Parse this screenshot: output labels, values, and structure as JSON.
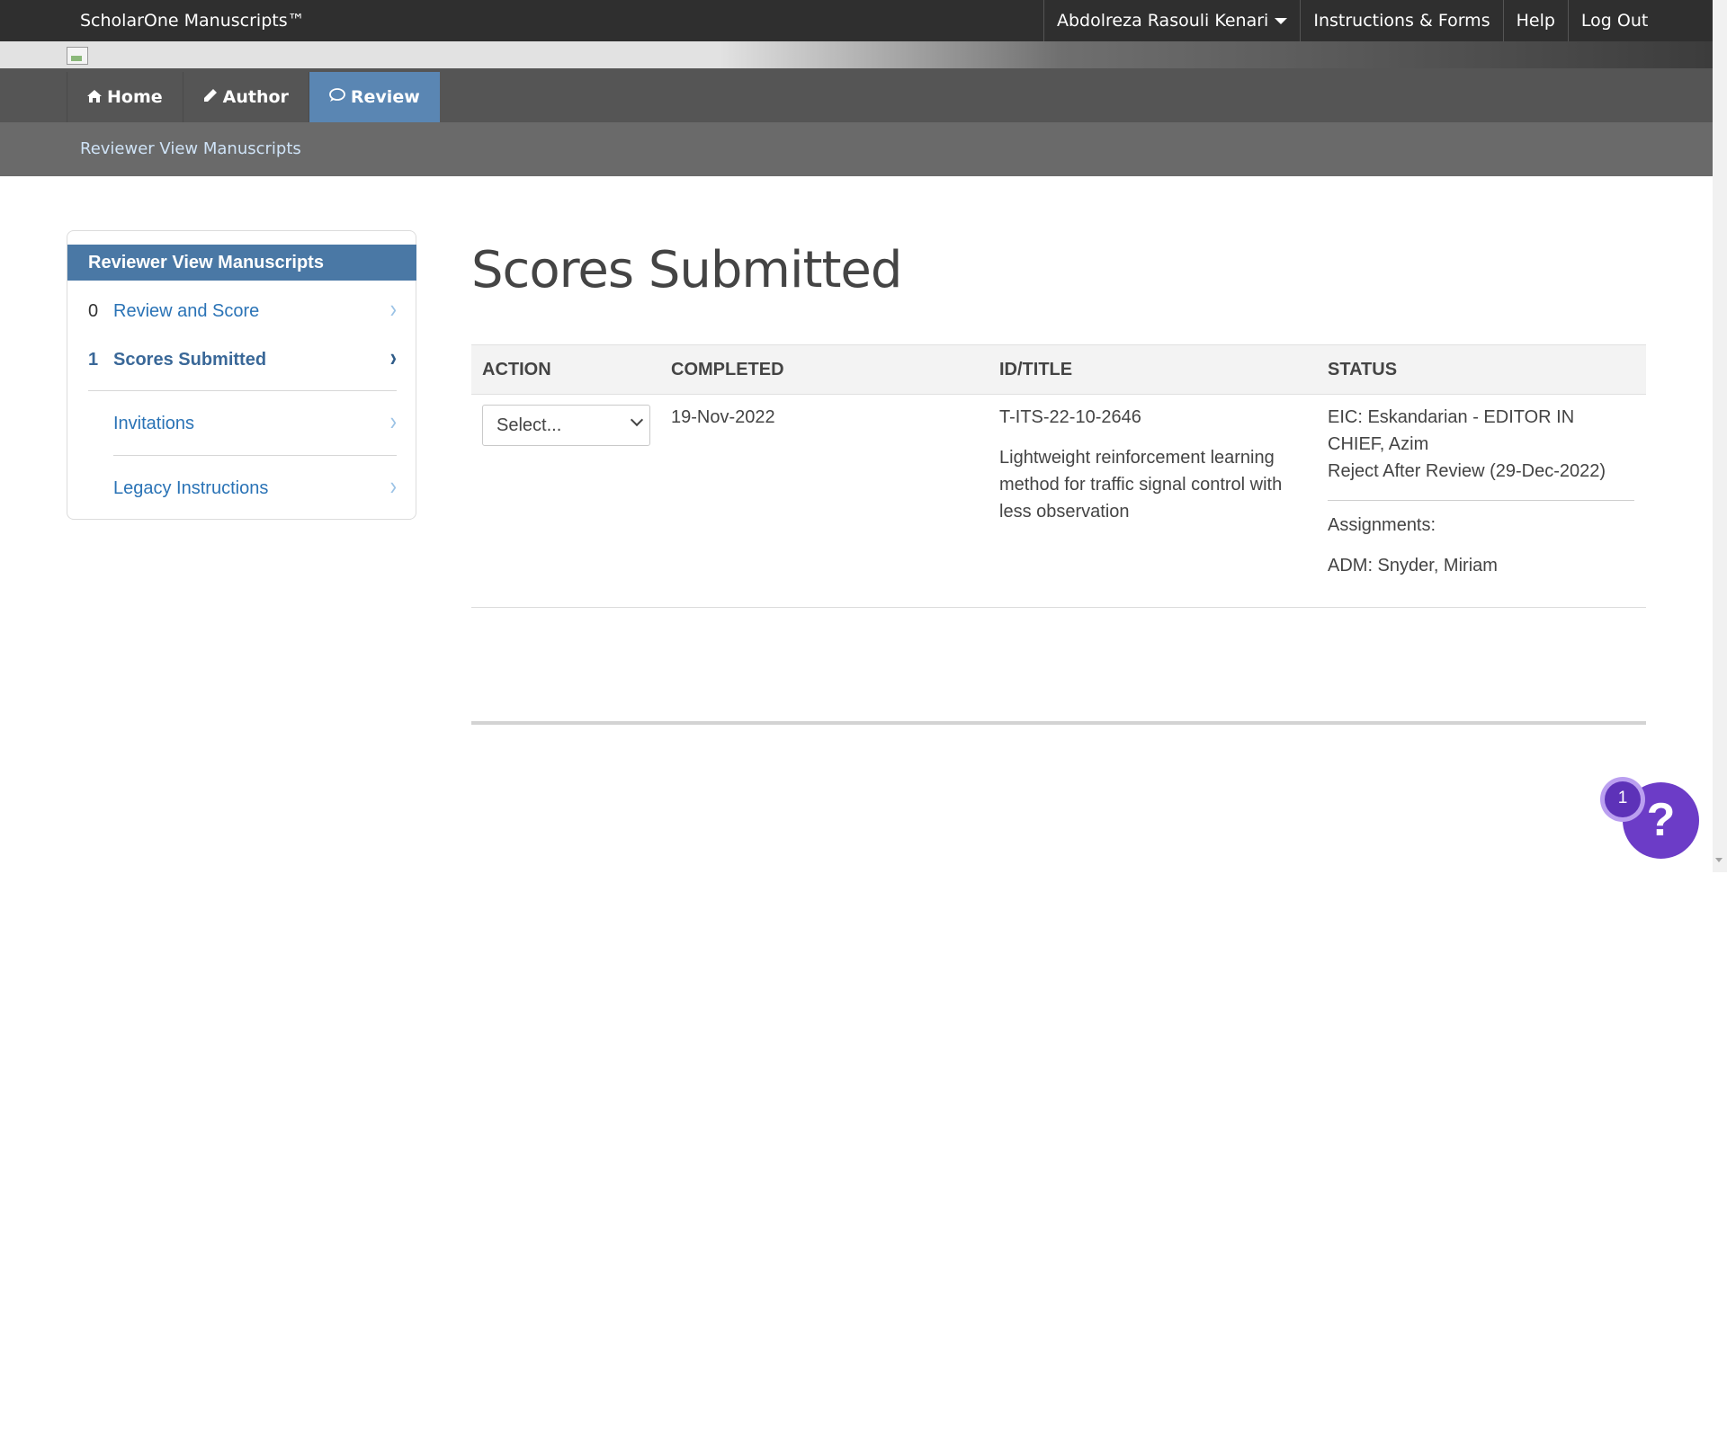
{
  "topbar": {
    "brand": "ScholarOne Manuscripts™",
    "user_name": "Abdolreza Rasouli Kenari",
    "links": [
      "Instructions & Forms",
      "Help",
      "Log Out"
    ]
  },
  "main_nav": {
    "tabs": [
      {
        "icon": "home-icon",
        "label": "Home"
      },
      {
        "icon": "pencil-icon",
        "label": "Author"
      },
      {
        "icon": "speech-bubble-icon",
        "label": "Review"
      }
    ],
    "active": "Review"
  },
  "sub_nav": {
    "breadcrumb": "Reviewer View Manuscripts"
  },
  "sidebar": {
    "title": "Reviewer View Manuscripts",
    "items": [
      {
        "count": "0",
        "label": "Review and Score"
      },
      {
        "count": "1",
        "label": "Scores Submitted"
      },
      {
        "count": "",
        "label": "Invitations"
      },
      {
        "count": "",
        "label": "Legacy Instructions"
      }
    ],
    "active": "Scores Submitted"
  },
  "main": {
    "title": "Scores Submitted",
    "table": {
      "headers": [
        "ACTION",
        "COMPLETED",
        "ID/TITLE",
        "STATUS"
      ],
      "rows": [
        {
          "action_select": "Select...",
          "completed": "19-Nov-2022",
          "id": "T-ITS-22-10-2646",
          "title_lines": [
            "Lightweight reinforcement learning",
            "method for traffic signal control with",
            "less observation"
          ],
          "status_lines": [
            "EIC: Eskandarian - EDITOR IN",
            "CHIEF, Azim",
            "Reject After Review (29-Dec-2022)"
          ],
          "assignments_label": "Assignments:",
          "assignments": "ADM: Snyder, Miriam"
        }
      ]
    }
  },
  "help_widget": {
    "badge_count": "1",
    "symbol": "?"
  },
  "colors": {
    "topbar_bg": "#2f2f2f",
    "nav_bg": "#555555",
    "active_tab": "#5a86b3",
    "subnav_bg": "#6a6a6a",
    "sidebar_header": "#4a78a5",
    "link": "#2a73b6",
    "help_purple": "#6c3cc7"
  }
}
